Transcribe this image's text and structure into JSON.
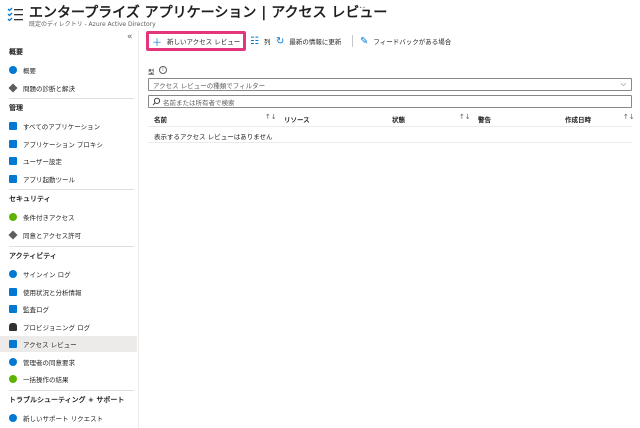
{
  "header": {
    "title": "エンタープライズ アプリケーション | アクセス レビュー",
    "subtitle": "既定のディレクトリ - Azure Active Directory",
    "more": "···",
    "logo_icon": "list-check-icon"
  },
  "sidebar": {
    "collapse": "«",
    "sections": [
      {
        "title": "概要",
        "items": [
          {
            "label": "概要",
            "icon": "info-icon",
            "color": "#0078d4"
          },
          {
            "label": "問題の診断と解決",
            "icon": "wrench-icon",
            "color": "#605e5c"
          }
        ]
      },
      {
        "title": "管理",
        "items": [
          {
            "label": "すべてのアプリケーション",
            "icon": "grid-icon",
            "color": "#0078d4"
          },
          {
            "label": "アプリケーション プロキシ",
            "icon": "proxy-icon",
            "color": "#0078d4"
          },
          {
            "label": "ユーザー設定",
            "icon": "user-settings-icon",
            "color": "#0078d4"
          },
          {
            "label": "アプリ起動ツール",
            "icon": "launcher-icon",
            "color": "#0078d4"
          }
        ]
      },
      {
        "title": "セキュリティ",
        "items": [
          {
            "label": "条件付きアクセス",
            "icon": "conditional-access-icon",
            "color": "#5db300"
          },
          {
            "label": "同意とアクセス許可",
            "icon": "cube-icon",
            "color": "#605e5c"
          }
        ]
      },
      {
        "title": "アクティビティ",
        "items": [
          {
            "label": "サインイン ログ",
            "icon": "signin-icon",
            "color": "#0078d4"
          },
          {
            "label": "使用状況と分析情報",
            "icon": "chart-icon",
            "color": "#0078d4"
          },
          {
            "label": "監査ログ",
            "icon": "audit-log-icon",
            "color": "#0078d4"
          },
          {
            "label": "プロビジョニング ログ",
            "icon": "person-icon",
            "color": "#323130"
          },
          {
            "label": "アクセス レビュー",
            "icon": "list-check-icon",
            "color": "#0078d4",
            "active": true
          },
          {
            "label": "管理者の同意要求",
            "icon": "globe-icon",
            "color": "#0078d4"
          },
          {
            "label": "一括操作の結果",
            "icon": "group-icon",
            "color": "#5db300"
          }
        ]
      },
      {
        "title": "トラブルシューティング + サポート",
        "items": [
          {
            "label": "新しいサポート リクエスト",
            "icon": "support-icon",
            "color": "#0078d4"
          }
        ]
      }
    ]
  },
  "toolbar": {
    "new_review": "新しいアクセス レビュー",
    "new_icon": "plus-icon",
    "columns": "列",
    "columns_icon": "columns-icon",
    "refresh": "最新の情報に更新",
    "refresh_icon": "refresh-icon",
    "feedback": "フィードバックがある場合",
    "feedback_icon": "feedback-icon",
    "highlight_color": "#e6367b"
  },
  "main": {
    "type_label": "型",
    "info_icon": "i",
    "filter_placeholder": "アクセス レビューの種類でフィルター",
    "search_placeholder": "名前または所有者で検索",
    "columns": [
      "名前",
      "リソース",
      "状態",
      "警告",
      "作成日時"
    ],
    "empty_message": "表示するアクセス レビューはありません"
  }
}
